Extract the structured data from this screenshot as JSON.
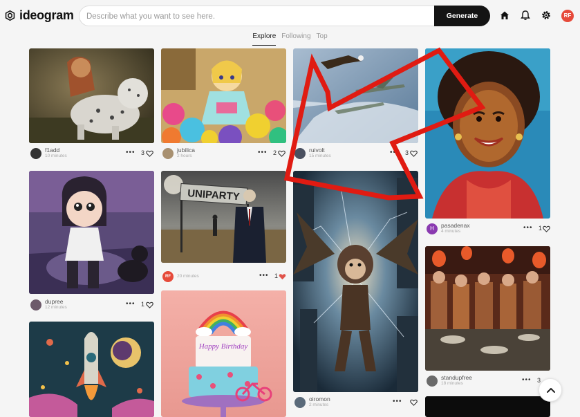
{
  "header": {
    "logo_text": "ideogram",
    "search_placeholder": "Describe what you want to see here.",
    "generate_label": "Generate",
    "user_initials": "RF"
  },
  "tabs": [
    {
      "label": "Explore",
      "active": true
    },
    {
      "label": "Following",
      "active": false
    },
    {
      "label": "Top",
      "active": false
    }
  ],
  "posts": [
    {
      "user": "f1add",
      "time": "10 minutes",
      "likes": "3",
      "image": "snow leopard cub with costumed figure"
    },
    {
      "user": "jubilica",
      "time": "2 hours",
      "likes": "2",
      "image": "girl with birthday cake and balloons"
    },
    {
      "user": "ruivolt",
      "time": "15 minutes",
      "likes": "3",
      "image": "eagle and fighter jets in sky"
    },
    {
      "user": "pasadenax",
      "time": "4 minutes",
      "likes": "1",
      "image": "painted portrait of smiling woman"
    },
    {
      "user": "dupree",
      "time": "12 minutes",
      "likes": "1",
      "image": "3D cartoon girl with cat"
    },
    {
      "user": "",
      "avatar_initials": "RF",
      "time": "20 minutes",
      "likes": "1",
      "liked": true,
      "image": "man in suit with UNIPARTY sign",
      "sign_text": "UNIPARTY"
    },
    {
      "user": "oiromon",
      "time": "2 minutes",
      "likes": "",
      "image": "flying monkey in glowing city"
    },
    {
      "user": "standupfree",
      "time": "18 minutes",
      "likes": "3",
      "image": "terracotta warriors at dining table"
    },
    {
      "image": "rocket and planets illustration"
    },
    {
      "image": "birthday cake with rainbow and bicycle",
      "cake_text": "Happy Birthday"
    }
  ],
  "colors": {
    "accent_red": "#e01b12",
    "heart_liked": "#e0534a",
    "button_dark": "#141414"
  }
}
